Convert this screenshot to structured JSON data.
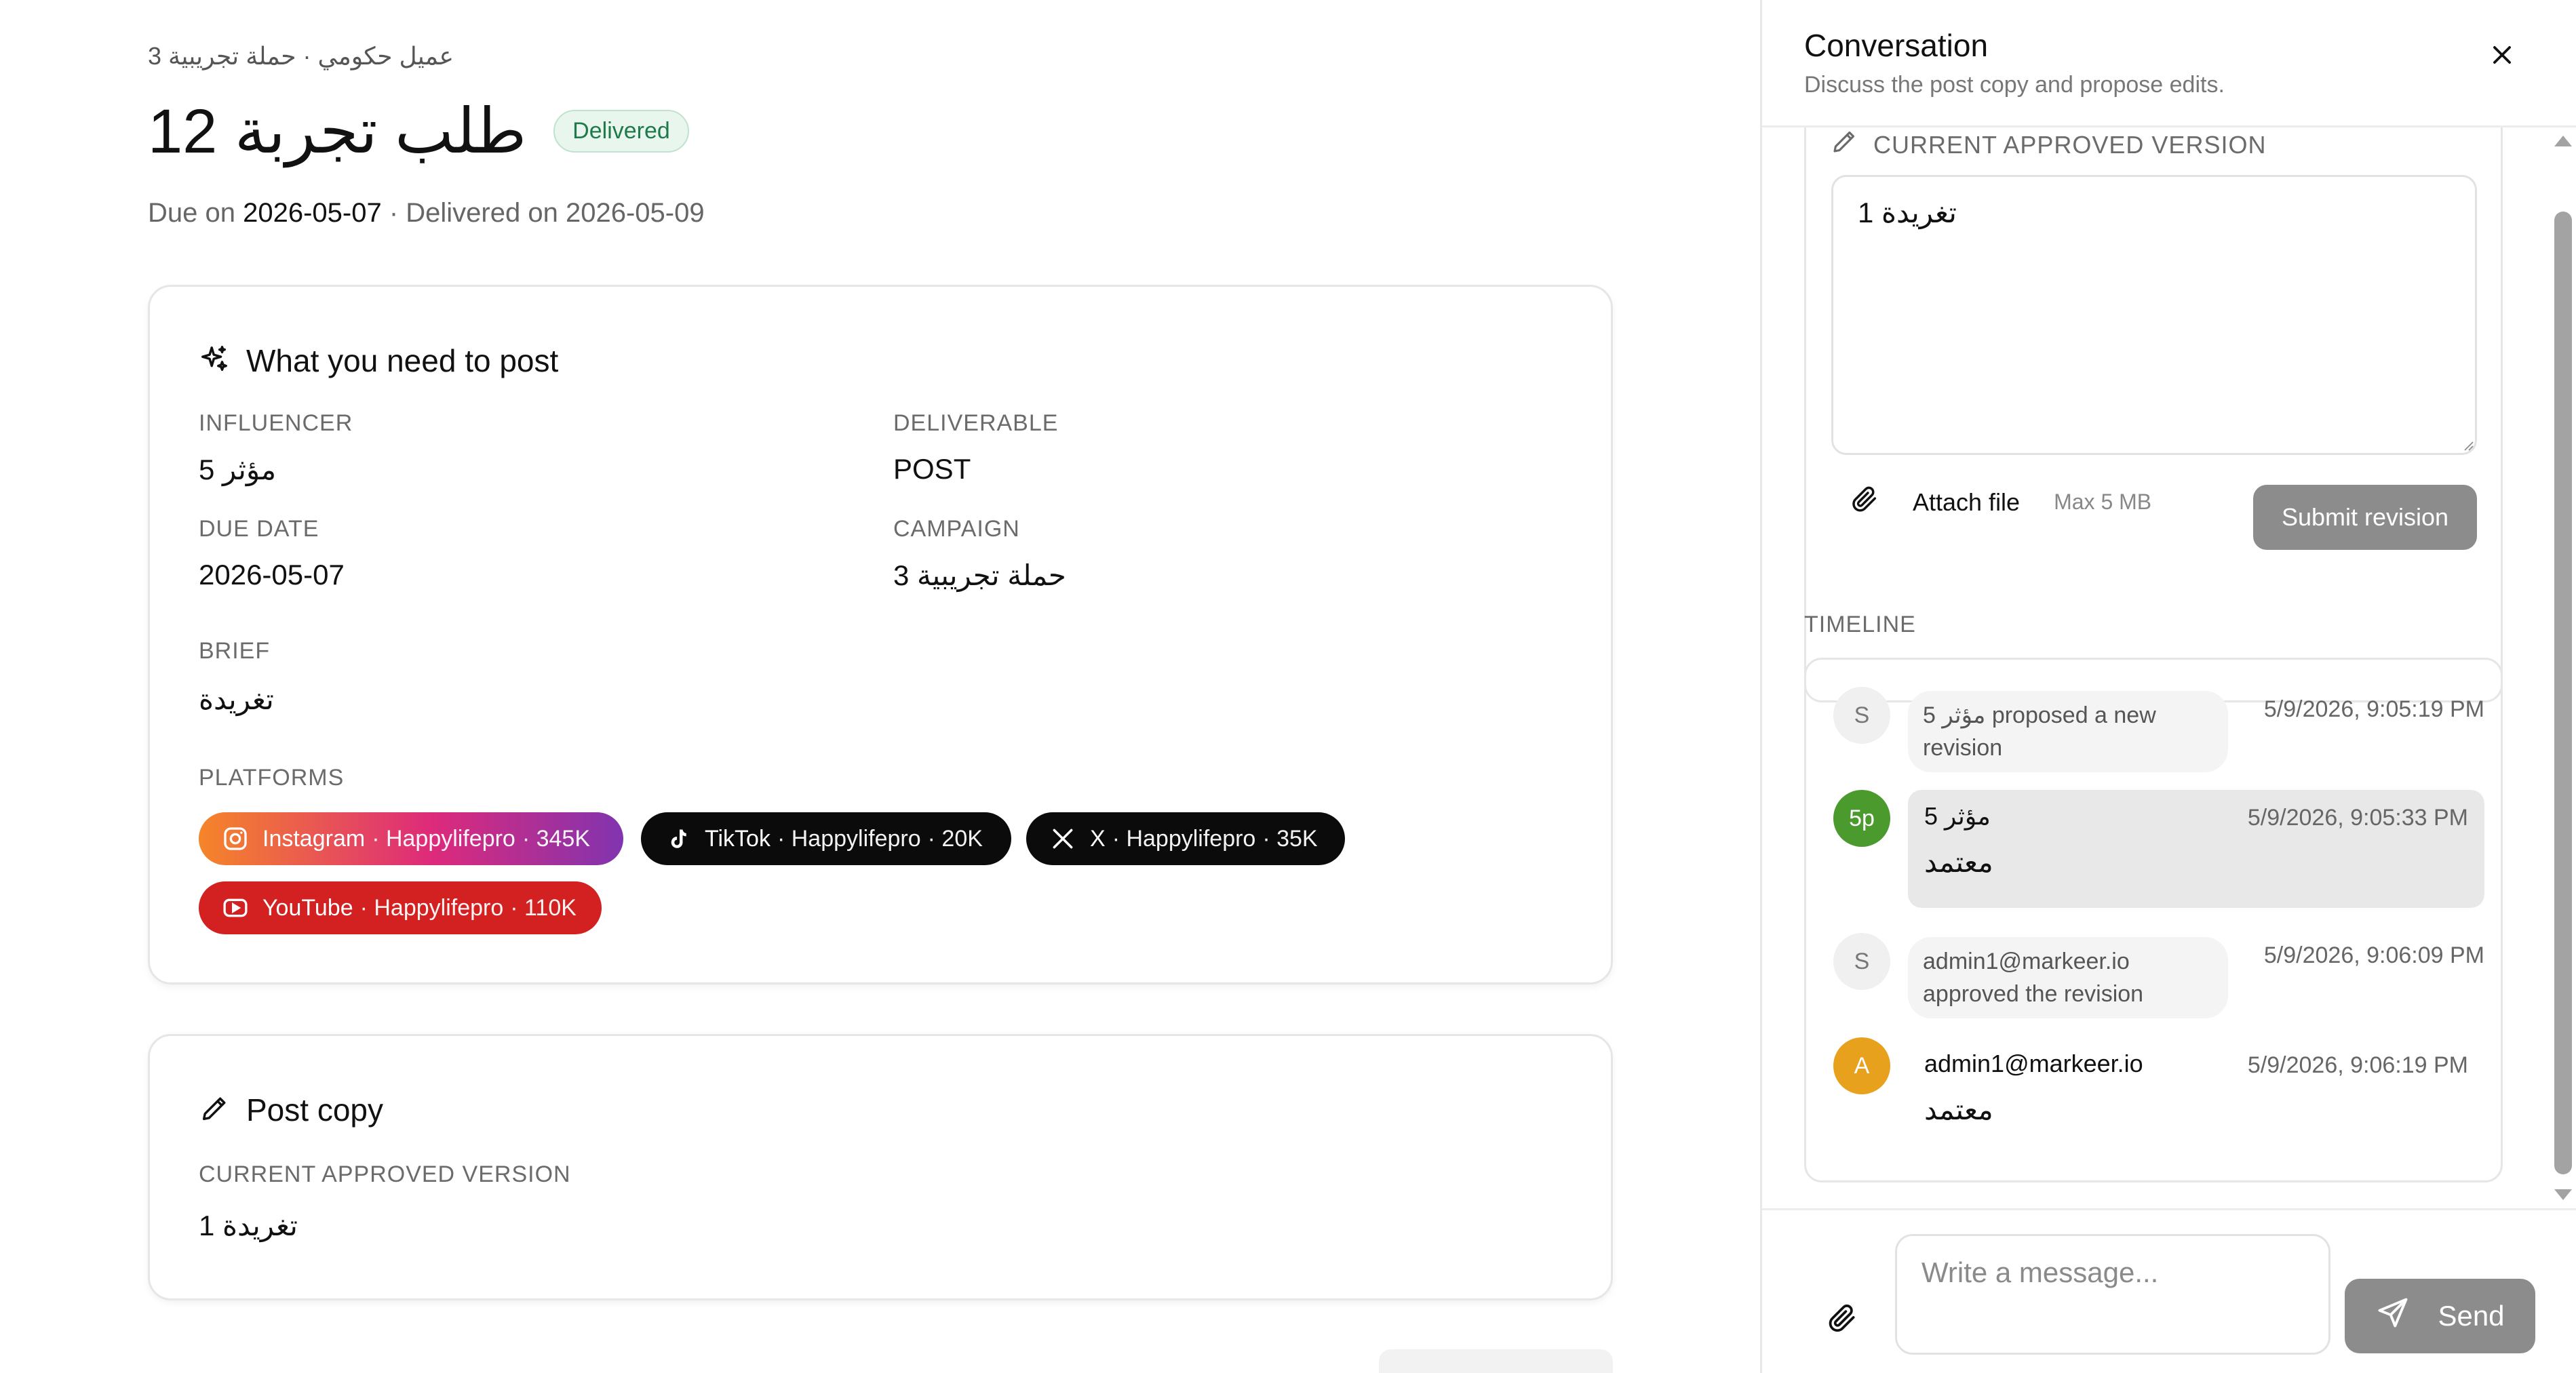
{
  "page": {
    "breadcrumb": "عميل حكومي · حملة تجريبية 3",
    "title": "طلب تجربة 12",
    "status_badge": "Delivered",
    "due_prefix": "Due on",
    "due_date": "2026-05-07",
    "delivered_prefix": "· Delivered on",
    "delivered_date": "2026-05-09"
  },
  "post_card": {
    "title": "What you need to post",
    "influencer_label": "INFLUENCER",
    "influencer_value": "مؤثر 5",
    "deliverable_label": "DELIVERABLE",
    "deliverable_value": "POST",
    "due_label": "DUE DATE",
    "due_value": "2026-05-07",
    "campaign_label": "CAMPAIGN",
    "campaign_value": "حملة تجريبية 3",
    "brief_label": "BRIEF",
    "brief_value": "تغريدة",
    "platforms_label": "PLATFORMS",
    "platforms": [
      {
        "name": "Instagram",
        "handle": "· Happylifepro",
        "followers": "· 345K",
        "icon": "instagram-icon"
      },
      {
        "name": "TikTok",
        "handle": "· Happylifepro",
        "followers": "· 20K",
        "icon": "tiktok-icon"
      },
      {
        "name": "X",
        "handle": "· Happylifepro",
        "followers": "· 35K",
        "icon": "x-icon"
      },
      {
        "name": "YouTube",
        "handle": "· Happylifepro",
        "followers": "· 110K",
        "icon": "youtube-icon"
      }
    ]
  },
  "copy_card": {
    "title": "Post copy",
    "version_label": "CURRENT APPROVED VERSION",
    "version_value": "تغريدة 1"
  },
  "panel": {
    "title": "Conversation",
    "subtitle": "Discuss the post copy and propose edits.",
    "editor_label": "CURRENT APPROVED VERSION",
    "editor_value": "تغريدة 1",
    "attach_label": "Attach file",
    "max_size": "Max 5 MB",
    "submit_label": "Submit revision",
    "timeline_label": "TIMELINE",
    "timeline": [
      {
        "kind": "system",
        "avatar": "S",
        "text": "مؤثر 5 proposed a new revision",
        "time": "5/9/2026, 9:05:19 PM"
      },
      {
        "kind": "message",
        "avatar": "5p",
        "author": "مؤثر 5",
        "time": "5/9/2026, 9:05:33 PM",
        "body": "معتمد"
      },
      {
        "kind": "system",
        "avatar": "S",
        "text": "admin1@markeer.io approved the revision",
        "time": "5/9/2026, 9:06:09 PM"
      },
      {
        "kind": "message",
        "avatar": "A",
        "author": "admin1@markeer.io",
        "time": "5/9/2026, 9:06:19 PM",
        "body": "معتمد"
      }
    ],
    "compose_placeholder": "Write a message...",
    "send_label": "Send"
  },
  "colors": {
    "instagram_start": "#f58529",
    "instagram_end": "#8134af",
    "tiktok": "#0b0b0b",
    "x": "#0b0b0b",
    "youtube": "#d32020",
    "avatar_green": "#4a9a2e",
    "avatar_orange": "#e8a11d",
    "button_gray": "#8c8c8c",
    "badge_green": "#1f7a4a"
  }
}
